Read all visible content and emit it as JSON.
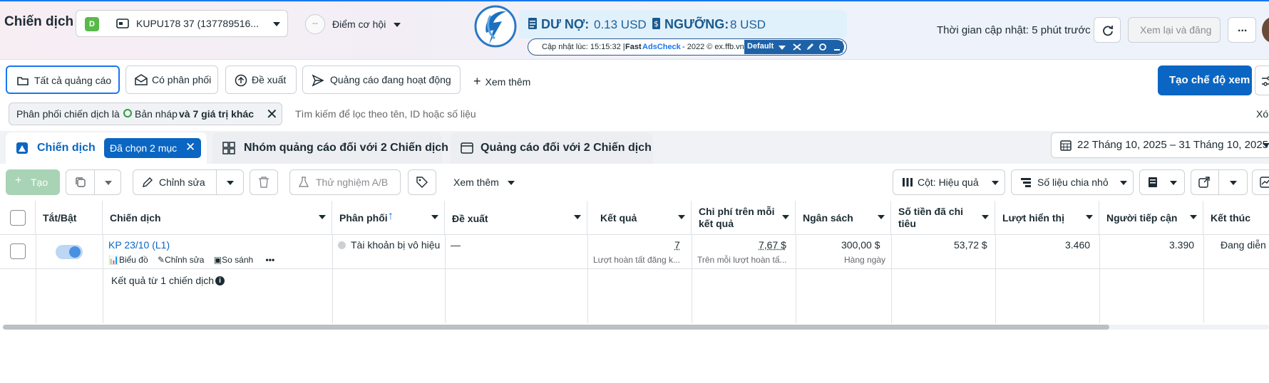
{
  "header": {
    "title": "Chiến dịch",
    "account_badge": "D",
    "account_name": "KUPU178 37 (137789516...",
    "opportunity_label": "Điểm cơ hội",
    "opportunity_dot": "--",
    "updated_text": "Thời gian cập nhật: 5 phút trước",
    "review_button": "Xem lại và đăng",
    "more_label": "..."
  },
  "extension": {
    "debt_label": "DƯ NỢ:",
    "debt_value": "0.13 USD",
    "threshold_label": "NGƯỠNG:",
    "threshold_value": "8 USD",
    "update_time": "Cập nhật lúc: 15:15:32 |",
    "brand_fast": "Fast",
    "brand_name": "AdsCheck",
    "copyright": "- 2022 © ex.ffb.vn",
    "profile": "Default"
  },
  "filter_tabs": {
    "all_ads": "Tất cả quảng cáo",
    "with_delivery": "Có phân phối",
    "recommendations": "Đề xuất",
    "active_ads": "Quảng cáo đang hoạt động",
    "see_more": "Xem thêm",
    "create_view": "Tạo chế độ xem"
  },
  "search": {
    "chip_prefix": "Phân phối chiến dịch là",
    "chip_value": "Bản nháp",
    "chip_more": "và 7 giá trị khác",
    "placeholder": "Tìm kiếm để lọc theo tên, ID hoặc số liệu",
    "clear": "Xó"
  },
  "level_tabs": {
    "campaigns": "Chiến dịch",
    "selected": "Đã chọn 2 mục",
    "adsets": "Nhóm quảng cáo đối với 2 Chiến dịch",
    "ads": "Quảng cáo đối với 2 Chiến dịch",
    "date_range": "22 Tháng 10, 2025 – 31 Tháng 10, 2025"
  },
  "toolbar": {
    "create": "Tạo",
    "edit": "Chỉnh sửa",
    "ab_test": "Thử nghiệm A/B",
    "see_more": "Xem thêm",
    "columns": "Cột: Hiệu quả",
    "breakdown": "Số liệu chia nhỏ"
  },
  "table": {
    "columns": [
      "Tắt/Bật",
      "Chiến dịch",
      "Phân phối",
      "Đề xuất",
      "Kết quả",
      "Chi phí trên mỗi kết quả",
      "Ngân sách",
      "Số tiền đã chi tiêu",
      "Lượt hiển thị",
      "Người tiếp cận",
      "Kết thúc"
    ],
    "row": {
      "name": "KP 23/10 (L1)",
      "action_chart": "Biểu đồ",
      "action_edit": "Chỉnh sửa",
      "action_compare": "So sánh",
      "action_more": "•••",
      "delivery": "Tài khoản bị vô hiệu",
      "recommendation": "—",
      "results": "7",
      "results_sub": "Lượt hoàn tất đăng k...",
      "cost_per_result": "7,67 $",
      "cost_sub": "Trên mỗi lượt hoàn tấ...",
      "budget": "300,00 $",
      "budget_sub": "Hàng ngày",
      "spent": "53,72 $",
      "impressions": "3.460",
      "reach": "3.390",
      "end": "Đang diễn"
    },
    "summary": "Kết quả từ 1 chiến dịch"
  },
  "colors": {
    "accent": "#0a66c2",
    "link": "#1877f2",
    "create_disabled": "#a8d3b4",
    "extension_bg": "#e1f1fb"
  }
}
